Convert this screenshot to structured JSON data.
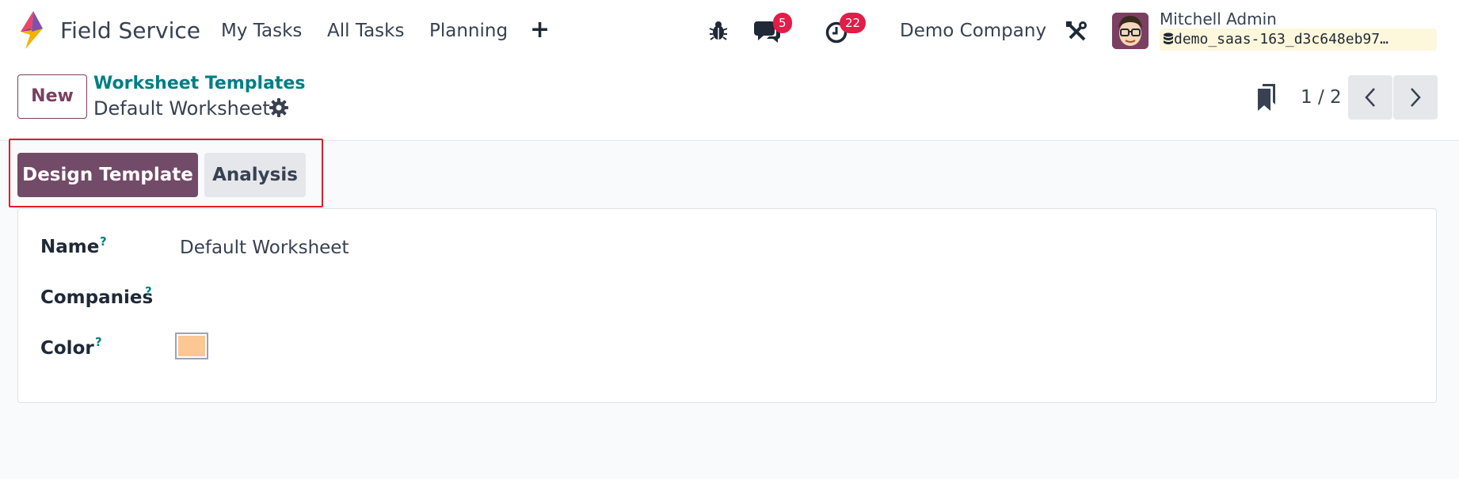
{
  "navbar": {
    "app_name": "Field Service",
    "menus": [
      "My Tasks",
      "All Tasks",
      "Planning"
    ],
    "plus_label": "+",
    "messages_count": "5",
    "activities_count": "22",
    "company": "Demo Company",
    "user_name": "Mitchell Admin",
    "database": "demo_saas-163_d3c648eb97…",
    "icons": [
      "debug-bug-icon",
      "messages-chat-icon",
      "activity-clock-icon",
      "tools-wrench-icon",
      "database-icon"
    ]
  },
  "control_panel": {
    "new_label": "New",
    "breadcrumb_parent": "Worksheet Templates",
    "breadcrumb_current": "Default Worksheet",
    "pager_value": "1 / 2"
  },
  "actions": {
    "design_template_label": "Design Template",
    "analysis_label": "Analysis"
  },
  "form": {
    "name_label": "Name",
    "name_value": "Default Worksheet",
    "companies_label": "Companies",
    "companies_value": "",
    "color_label": "Color",
    "help_mark": "?"
  },
  "colors": {
    "brand": "#714b67",
    "breadcrumb_link": "#017e84",
    "badge": "#e11d48",
    "highlight_box": "#e11d2a",
    "selected_color": "#fbc793"
  }
}
